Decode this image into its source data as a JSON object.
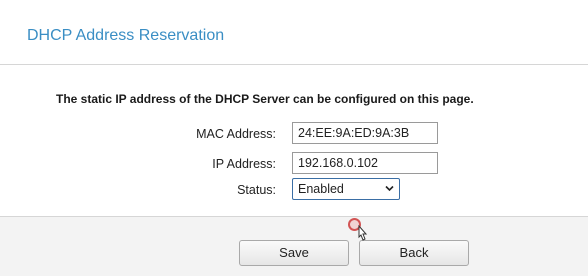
{
  "header": {
    "title": "DHCP Address Reservation"
  },
  "form": {
    "description": "The static IP address of the DHCP Server can be configured on this page.",
    "mac": {
      "label": "MAC Address:",
      "value": "24:EE:9A:ED:9A:3B"
    },
    "ip": {
      "label": "IP Address:",
      "value": "192.168.0.102"
    },
    "status": {
      "label": "Status:",
      "value": "Enabled"
    }
  },
  "buttons": {
    "save": "Save",
    "back": "Back"
  },
  "colors": {
    "title": "#3a8ec4",
    "click_indicator": "#d25454"
  }
}
